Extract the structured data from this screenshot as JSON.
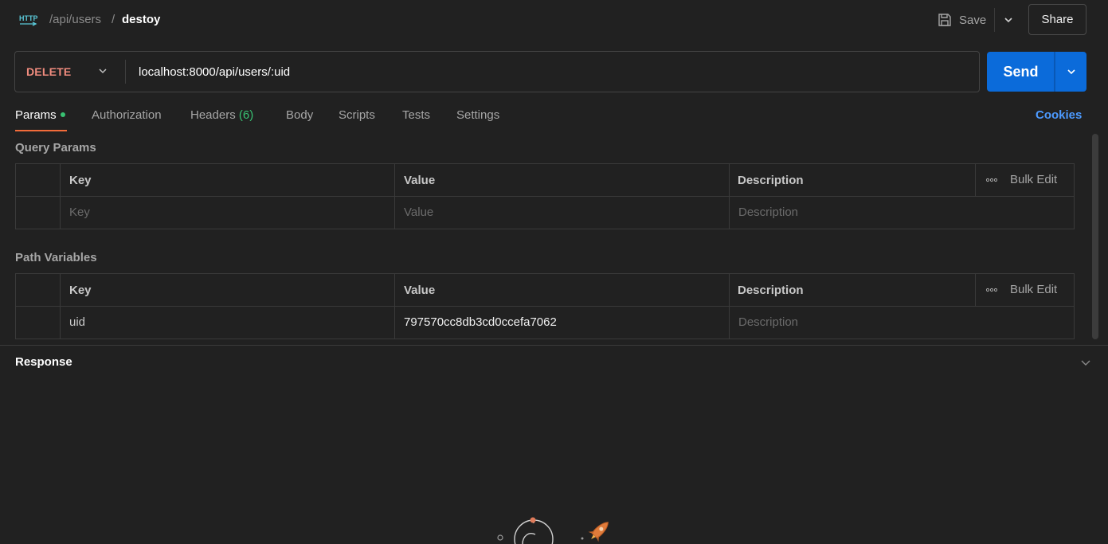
{
  "header": {
    "icon": "http-icon",
    "breadcrumb_parent": "/api/users",
    "breadcrumb_separator": "/",
    "breadcrumb_current": "destoy",
    "save_label": "Save",
    "share_label": "Share"
  },
  "request": {
    "method": "DELETE",
    "method_color": "#f18c7e",
    "url": "localhost:8000/api/users/:uid",
    "send_label": "Send",
    "send_color": "#0b6bda"
  },
  "tabs": [
    {
      "label": "Params",
      "active": true,
      "indicator": "green-dot"
    },
    {
      "label": "Authorization"
    },
    {
      "label": "Headers",
      "count": "(6)"
    },
    {
      "label": "Body"
    },
    {
      "label": "Scripts"
    },
    {
      "label": "Tests"
    },
    {
      "label": "Settings"
    }
  ],
  "cookies_label": "Cookies",
  "query_params": {
    "title": "Query Params",
    "headers": {
      "key": "Key",
      "value": "Value",
      "description": "Description",
      "bulk_edit": "Bulk Edit"
    },
    "row": {
      "key_placeholder": "Key",
      "value_placeholder": "Value",
      "description_placeholder": "Description"
    }
  },
  "path_variables": {
    "title": "Path Variables",
    "headers": {
      "key": "Key",
      "value": "Value",
      "description": "Description",
      "bulk_edit": "Bulk Edit"
    },
    "row": {
      "key": "uid",
      "value": "797570cc8db3cd0ccefa7062",
      "description_placeholder": "Description"
    }
  },
  "response": {
    "title": "Response"
  }
}
